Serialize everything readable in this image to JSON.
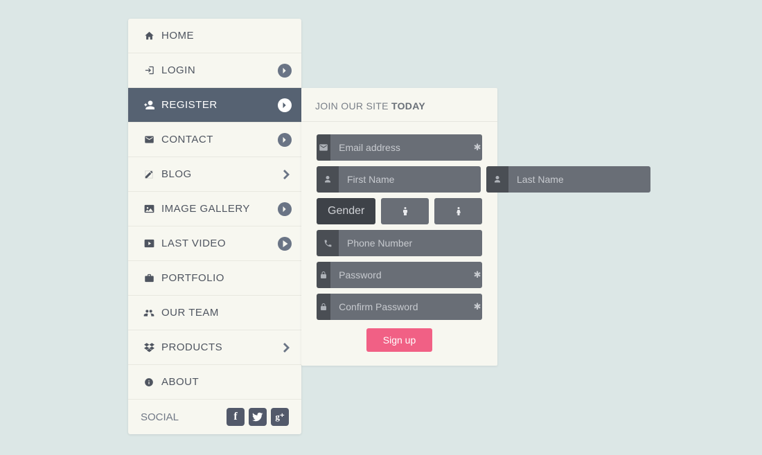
{
  "sidebar": {
    "items": [
      {
        "label": "HOME",
        "icon": "home",
        "arrow": "none"
      },
      {
        "label": "LOGIN",
        "icon": "signin",
        "arrow": "circle"
      },
      {
        "label": "REGISTER",
        "icon": "user-plus",
        "arrow": "circle",
        "active": true
      },
      {
        "label": "CONTACT",
        "icon": "mail",
        "arrow": "circle"
      },
      {
        "label": "BLOG",
        "icon": "edit",
        "arrow": "plain"
      },
      {
        "label": "IMAGE GALLERY",
        "icon": "image",
        "arrow": "circle"
      },
      {
        "label": "LAST VIDEO",
        "icon": "video",
        "arrow": "play"
      },
      {
        "label": "PORTFOLIO",
        "icon": "briefcase",
        "arrow": "none"
      },
      {
        "label": "OUR TEAM",
        "icon": "group",
        "arrow": "none"
      },
      {
        "label": "PRODUCTS",
        "icon": "dropbox",
        "arrow": "plain"
      },
      {
        "label": "ABOUT",
        "icon": "info",
        "arrow": "none"
      }
    ],
    "social_label": "SOCIAL"
  },
  "panel": {
    "heading_pre": "JOIN OUR SITE ",
    "heading_strong": "TODAY",
    "email_ph": "Email address",
    "first_ph": "First Name",
    "last_ph": "Last Name",
    "gender_label": "Gender",
    "phone_ph": "Phone Number",
    "password_ph": "Password",
    "confirm_ph": "Confirm Password",
    "signup_label": "Sign up"
  }
}
